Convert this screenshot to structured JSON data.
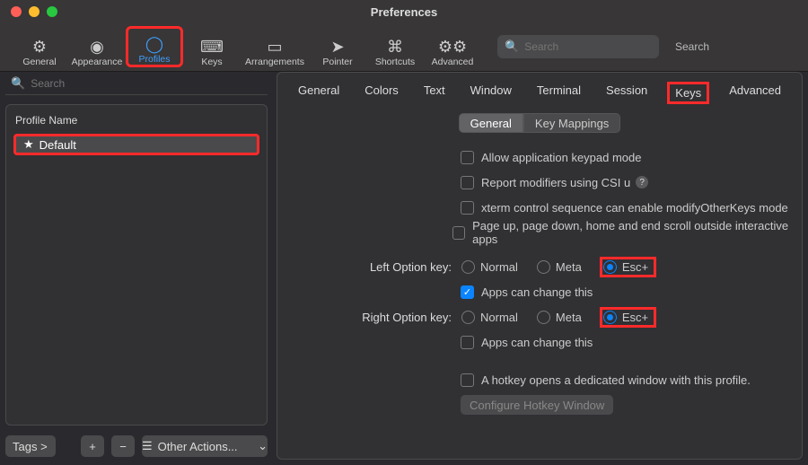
{
  "window": {
    "title": "Preferences"
  },
  "toolbar": {
    "items": [
      {
        "label": "General"
      },
      {
        "label": "Appearance"
      },
      {
        "label": "Profiles"
      },
      {
        "label": "Keys"
      },
      {
        "label": "Arrangements"
      },
      {
        "label": "Pointer"
      },
      {
        "label": "Shortcuts"
      },
      {
        "label": "Advanced"
      }
    ],
    "search_placeholder": "Search",
    "search_label": "Search"
  },
  "sidebar": {
    "search_placeholder": "Search",
    "header": "Profile Name",
    "profile": "Default",
    "tags_button": "Tags >",
    "other_actions": "Other Actions..."
  },
  "subtabs": {
    "items": [
      "General",
      "Colors",
      "Text",
      "Window",
      "Terminal",
      "Session",
      "Keys",
      "Advanced"
    ],
    "active": "Keys"
  },
  "segmented": {
    "general": "General",
    "mappings": "Key Mappings"
  },
  "options": {
    "allow_keypad": "Allow application keypad mode",
    "report_csi": "Report modifiers using CSI u",
    "xterm_modify": "xterm control sequence can enable modifyOtherKeys mode",
    "page_scroll": "Page up, page down, home and end scroll outside interactive apps",
    "left_opt_label": "Left Option key:",
    "right_opt_label": "Right Option key:",
    "normal": "Normal",
    "meta": "Meta",
    "escplus": "Esc+",
    "apps_change": "Apps can change this",
    "hotkey_text": "A hotkey opens a dedicated window with this profile.",
    "configure_hotkey": "Configure Hotkey Window"
  }
}
